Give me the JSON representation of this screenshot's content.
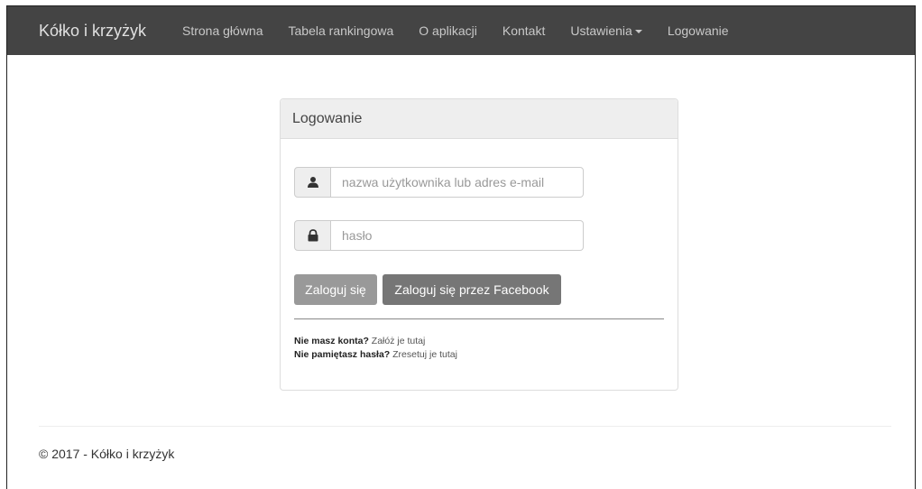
{
  "navbar": {
    "brand": "Kółko i krzyżyk",
    "items": [
      {
        "label": "Strona główna"
      },
      {
        "label": "Tabela rankingowa"
      },
      {
        "label": "O aplikacji"
      },
      {
        "label": "Kontakt"
      },
      {
        "label": "Ustawienia"
      },
      {
        "label": "Logowanie"
      }
    ],
    "background": "#444444"
  },
  "login": {
    "title": "Logowanie",
    "username": {
      "icon": "user-icon",
      "placeholder": "nazwa użytkownika lub adres e-mail",
      "value": ""
    },
    "password": {
      "icon": "lock-icon",
      "placeholder": "hasło",
      "value": ""
    },
    "login_button": "Zaloguj się",
    "facebook_button": "Zaloguj się przez Facebook",
    "no_account_question": "Nie masz konta?",
    "no_account_link": "Załóż je tutaj",
    "forgot_question": "Nie pamiętasz hasła?",
    "forgot_link": "Zresetuj je tutaj"
  },
  "footer": {
    "text": "© 2017 - Kółko i krzyżyk"
  }
}
